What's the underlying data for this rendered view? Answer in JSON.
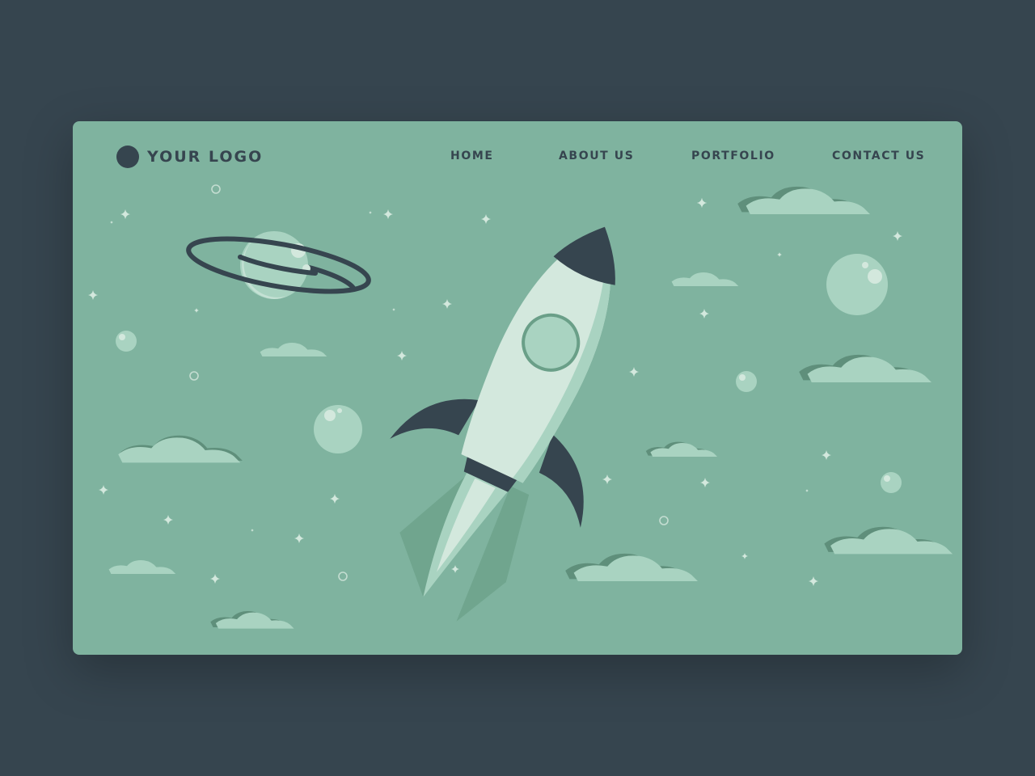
{
  "logo": {
    "text": "YOUR LOGO"
  },
  "nav": {
    "items": [
      {
        "label": "HOME"
      },
      {
        "label": "ABOUT US"
      },
      {
        "label": "PORTFOLIO"
      },
      {
        "label": "CONTACT US"
      }
    ]
  },
  "illustration": {
    "subject": "rocket-launch",
    "elements": [
      "rocket",
      "ringed-planet",
      "planets",
      "clouds",
      "stars"
    ]
  },
  "colors": {
    "page_background": "#36454f",
    "card_background": "#7fb39f",
    "dark": "#36454f",
    "light": "#d3e8dd",
    "mid_light": "#a9d3c1",
    "mid_dark": "#6a9f88",
    "cloud_shadow": "#5f8f7b"
  }
}
